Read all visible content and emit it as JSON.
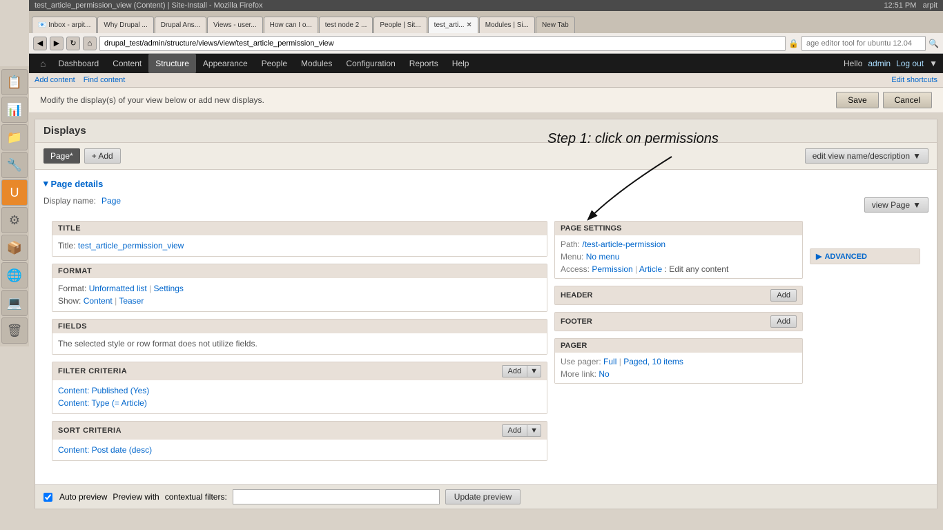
{
  "browser": {
    "title": "test_article_permission_view (Content) | Site-Install - Mozilla Firefox",
    "tabs": [
      {
        "label": "Inbox - arpit...",
        "active": false
      },
      {
        "label": "Why Drupal ...",
        "active": false
      },
      {
        "label": "Drupal Ans...",
        "active": false
      },
      {
        "label": "Views - user...",
        "active": false
      },
      {
        "label": "How can I o...",
        "active": false
      },
      {
        "label": "test node 2 ...",
        "active": false
      },
      {
        "label": "People | Sit...",
        "active": false
      },
      {
        "label": "test_arti...",
        "active": true
      },
      {
        "label": "Modules | Si...",
        "active": false
      },
      {
        "label": "New Tab",
        "active": false
      }
    ],
    "url": "drupal_test/admin/structure/views/view/test_article_permission_view",
    "search_placeholder": "age editor tool for ubuntu 12.04"
  },
  "admin_nav": {
    "home_icon": "⌂",
    "items": [
      {
        "label": "Dashboard",
        "active": false
      },
      {
        "label": "Content",
        "active": false
      },
      {
        "label": "Structure",
        "active": true
      },
      {
        "label": "Appearance",
        "active": false
      },
      {
        "label": "People",
        "active": false
      },
      {
        "label": "Modules",
        "active": false
      },
      {
        "label": "Configuration",
        "active": false
      },
      {
        "label": "Reports",
        "active": false
      },
      {
        "label": "Help",
        "active": false
      }
    ],
    "hello_label": "Hello",
    "admin_label": "admin",
    "logout_label": "Log out",
    "edit_shortcuts_label": "Edit shortcuts"
  },
  "shortcuts": {
    "add_content": "Add content",
    "find_content": "Find content",
    "edit_shortcuts": "Edit shortcuts"
  },
  "page": {
    "modify_text": "Modify the display(s) of your view below or add new displays.",
    "save_label": "Save",
    "cancel_label": "Cancel"
  },
  "displays": {
    "title": "Displays",
    "page_tab": "Page*",
    "add_label": "+ Add",
    "edit_view_label": "edit view name/description",
    "page_details_label": "▾ Page details",
    "display_name_label": "Display name:",
    "display_name_value": "Page",
    "view_page_label": "view Page"
  },
  "title_section": {
    "header": "TITLE",
    "label": "Title:",
    "value": "test_article_permission_view"
  },
  "format_section": {
    "header": "FORMAT",
    "format_label": "Format:",
    "format_value": "Unformatted list",
    "settings_label": "Settings",
    "show_label": "Show:",
    "show_content": "Content",
    "show_teaser": "Teaser"
  },
  "fields_section": {
    "header": "FIELDS",
    "text": "The selected style or row format does not utilize fields."
  },
  "filter_criteria": {
    "header": "FILTER CRITERIA",
    "add_label": "Add",
    "items": [
      "Content: Published (Yes)",
      "Content: Type (= Article)"
    ]
  },
  "sort_criteria": {
    "header": "SORT CRITERIA",
    "add_label": "Add",
    "items": [
      "Content: Post date (desc)"
    ]
  },
  "page_settings": {
    "header": "PAGE SETTINGS",
    "path_label": "Path:",
    "path_value": "/test-article-permission",
    "menu_label": "Menu:",
    "menu_value": "No menu",
    "access_label": "Access:",
    "access_permission": "Permission",
    "access_separator": "|",
    "access_article": "Article",
    "access_edit": ": Edit any content"
  },
  "header_section": {
    "header": "HEADER",
    "add_label": "Add"
  },
  "footer_section": {
    "header": "FOOTER",
    "add_label": "Add"
  },
  "pager_section": {
    "header": "PAGER",
    "use_pager_label": "Use pager:",
    "use_pager_full": "Full",
    "use_pager_separator": "|",
    "use_pager_paged": "Paged, 10 items",
    "more_link_label": "More link:",
    "more_link_value": "No"
  },
  "advanced_section": {
    "label": "▶ Advanced"
  },
  "annotation": {
    "text": "Step 1: click on permissions"
  },
  "auto_preview": {
    "checkbox_label": "Auto preview",
    "preview_with_label": "Preview with",
    "contextual_filters_label": "contextual filters:",
    "update_btn_label": "Update preview"
  },
  "sidebar_icons": [
    "📋",
    "📊",
    "📁",
    "🔧",
    "🅤",
    "⚙",
    "📦",
    "🌐",
    "💻",
    "🗑"
  ]
}
